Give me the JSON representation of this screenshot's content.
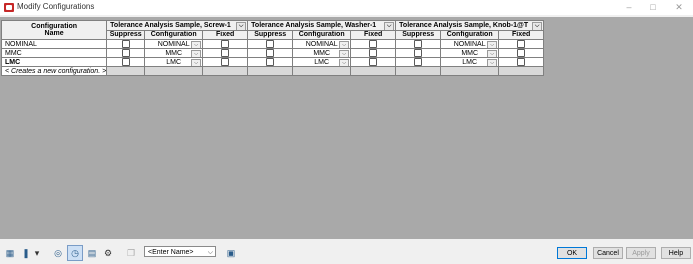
{
  "window": {
    "title": "Modify Configurations"
  },
  "grid": {
    "name_header": "Configuration\nName",
    "parts": [
      {
        "name": "Tolerance Analysis Sample, Screw-1"
      },
      {
        "name": "Tolerance Analysis Sample, Washer-1"
      },
      {
        "name": "Tolerance Analysis Sample, Knob-1@T"
      }
    ],
    "sub_headers": {
      "suppress": "Suppress",
      "configuration": "Configuration",
      "fixed": "Fixed"
    },
    "rows": [
      {
        "name": "NOMINAL",
        "configs": [
          "NOMINAL",
          "NOMINAL",
          "NOMINAL"
        ]
      },
      {
        "name": "MMC",
        "configs": [
          "MMC",
          "MMC",
          "MMC"
        ]
      },
      {
        "name": "LMC",
        "configs": [
          "LMC",
          "LMC",
          "LMC"
        ]
      }
    ],
    "new_row_label": "< Creates a new configuration. >"
  },
  "toolbar": {
    "icons": [
      "table-icon",
      "parameters-icon",
      "dropdown-arrow-icon",
      "globe-icon",
      "clock-icon",
      "sheet-icon",
      "gear-icon",
      "copy-icon",
      "view-icon"
    ],
    "combo_value": "<Enter Name>"
  },
  "buttons": {
    "ok": "OK",
    "cancel": "Cancel",
    "apply": "Apply",
    "help": "Help"
  },
  "colors": {
    "grid_background": "#a9a9a9",
    "app_icon": "#c62828",
    "ok_border": "#0078d7"
  }
}
